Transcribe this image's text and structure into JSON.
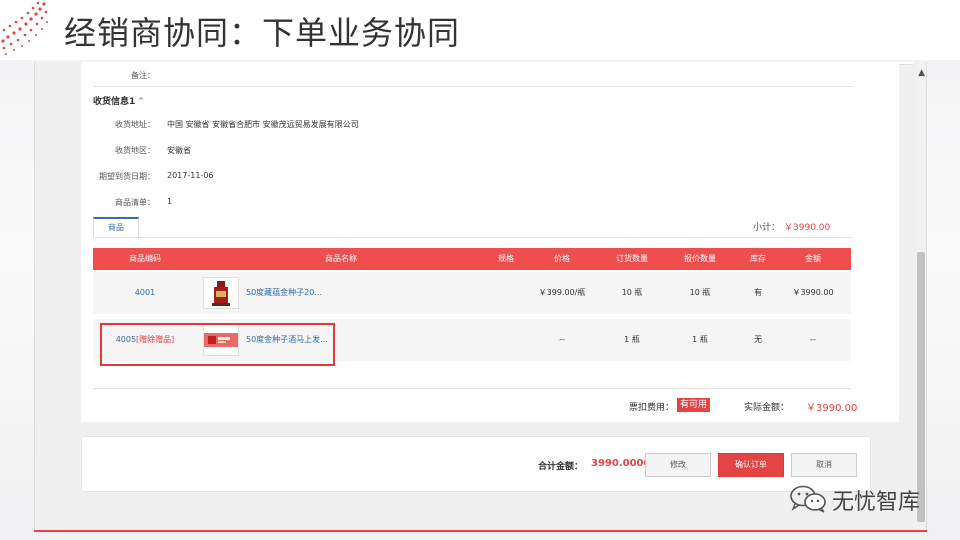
{
  "slide": {
    "title": "经销商协同：下单业务协同"
  },
  "order": {
    "remark_label": "备注：",
    "section_title": "收货信息1",
    "fields": [
      {
        "label": "收货地址：",
        "value": "中国 安徽省 安徽省合肥市 安徽茂远贸易发展有限公司"
      },
      {
        "label": "收货地区：",
        "value": "安徽省"
      },
      {
        "label": "期望到货日期：",
        "value": "2017-11-06"
      },
      {
        "label": "商品清单：",
        "value": "1"
      }
    ],
    "tab_label": "商品",
    "subtotal_label": "小计：",
    "subtotal_value": "￥3990.00"
  },
  "table": {
    "headers": [
      "商品编码",
      "商品名称",
      "规格",
      "价格",
      "订货数量",
      "报价数量",
      "库存",
      "金额"
    ],
    "rows": [
      {
        "code": "4001",
        "gift": "",
        "name": "50度藏蕴金种子20...",
        "spec": "",
        "price": "￥399.00/瓶",
        "order_qty": "10 瓶",
        "quote_qty": "10 瓶",
        "stock": "有",
        "amount": "￥3990.00"
      },
      {
        "code": "4005",
        "gift": "[赠除赠品]",
        "name": "50度金种子酒马上发...",
        "spec": "",
        "price": "--",
        "order_qty": "1 瓶",
        "quote_qty": "1 瓶",
        "stock": "无",
        "amount": "--"
      }
    ]
  },
  "summary": {
    "fee_label": "票扣费用：",
    "fee_badge": "有可用",
    "actual_label": "实际金额：",
    "actual_value": "￥3990.00"
  },
  "footer": {
    "total_label": "合计金额：",
    "total_value": "3990.0000",
    "modify_label": "修改",
    "confirm_label": "确认订单",
    "cancel_label": "取消"
  },
  "watermark": {
    "text": "无忧智库"
  },
  "colors": {
    "accent": "#e34545",
    "header_bg": "#ef4e4e",
    "link": "#2f6da8"
  },
  "icons": {
    "brand": "wechat-icon",
    "collapse": "chevron-up-icon"
  }
}
